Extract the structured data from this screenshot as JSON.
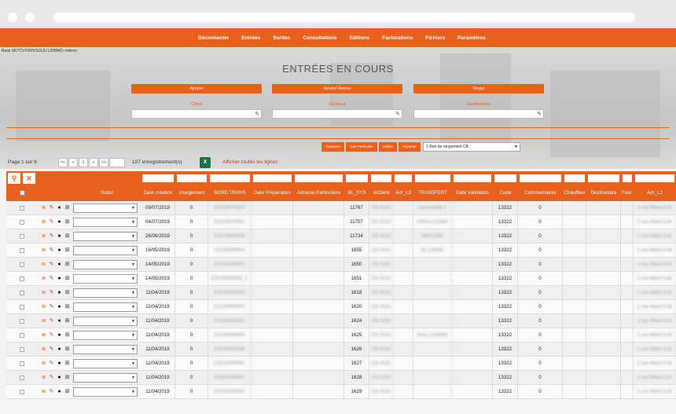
{
  "nav": {
    "items": [
      "Déconnecter",
      "Entrées",
      "Sorties",
      "Consultations",
      "Editions",
      "Facturations",
      "Fichiers",
      "Paramètres"
    ]
  },
  "base_label": "Base SKTCVXXRVSGUIJ UDBMO--ndemo",
  "page_title": "ENTRÉES EN COURS",
  "actions": {
    "add": "Ajouter",
    "add_return": "Ajouter Retour",
    "regul": "Regul"
  },
  "fields": {
    "client": "Client",
    "stockeur": "Stockeur",
    "destinataire": "Destinataire"
  },
  "small_buttons": [
    "Transport",
    "Cas Particulier",
    "Valider",
    "Imprimer"
  ],
  "doc_select": "1-Bon de rangement CB",
  "pagination": {
    "info": "Page 1 sur 6",
    "first": "<<",
    "prev": "<",
    "current": "1",
    "next": ">",
    "last": ">>",
    "records": "107 enregistrement(s)",
    "show_all": "Afficher toutes les lignes",
    "excel_letter": "X"
  },
  "icons": {
    "search": "search-icon",
    "clear": "close-icon"
  },
  "table": {
    "columns": [
      "Statut",
      "Date création",
      "chargement",
      "BORD TRANS",
      "Date Préparation",
      "Adresse Particuliere",
      "BL_SYS",
      "IoClient",
      "Adr_L3",
      "TRANSFERT",
      "Date Validation",
      "Code",
      "Commentaires",
      "Chauffeur",
      "Destinataire",
      "Four.",
      "Adr_L1"
    ],
    "rows": [
      {
        "date": "09/07/2019",
        "charg": "0",
        "bord": "E2019070004",
        "bl": "11767",
        "client": "CD-SUD",
        "transfert": "commande 1",
        "code": "13322",
        "comment": "0",
        "adr": "1 rue Albert Coll"
      },
      {
        "date": "04/07/2019",
        "charg": "0",
        "bord": "E2019070001",
        "bl": "11757",
        "client": "CD-SUD",
        "transfert": "CMAU123456",
        "code": "13322",
        "comment": "0",
        "adr": "1 rue Albert Coll"
      },
      {
        "date": "26/06/2019",
        "charg": "0",
        "bord": "E2019060006",
        "bl": "11734",
        "client": "CD-SUD",
        "transfert": "NM12359",
        "code": "13322",
        "comment": "0",
        "adr": "1 rue Albert Coll"
      },
      {
        "date": "16/05/2019",
        "charg": "0",
        "bord": "E2019050004",
        "bl": "1655",
        "client": "CD-SUD",
        "transfert": "BL123456",
        "code": "13322",
        "comment": "0",
        "adr": "1 rue Albert Coll"
      },
      {
        "date": "14/05/2019",
        "charg": "0",
        "bord": "E2019050003",
        "bl": "1650",
        "client": "CD-SUD",
        "transfert": "",
        "code": "13322",
        "comment": "0",
        "adr": "1 rue Albert Coll"
      },
      {
        "date": "14/05/2019",
        "charg": "0",
        "bord": "E2019050003_T",
        "bl": "1651",
        "client": "CD-SUD",
        "transfert": "",
        "code": "13322",
        "comment": "0",
        "adr": "1 rue Albert Coll"
      },
      {
        "date": "11/04/2019",
        "charg": "0",
        "bord": "E2019040049",
        "bl": "1618",
        "client": "CD-SUD",
        "transfert": "",
        "code": "13322",
        "comment": "0",
        "adr": "1 rue Albert Coll"
      },
      {
        "date": "11/04/2019",
        "charg": "0",
        "bord": "E2019040050",
        "bl": "1620",
        "client": "CD-SUD",
        "transfert": "",
        "code": "13322",
        "comment": "0",
        "adr": "1 rue Albert Coll"
      },
      {
        "date": "11/04/2019",
        "charg": "0",
        "bord": "E2019040055",
        "bl": "1624",
        "client": "CD-SUD",
        "transfert": "",
        "code": "13322",
        "comment": "0",
        "adr": "1 rue Albert Coll"
      },
      {
        "date": "11/04/2019",
        "charg": "0",
        "bord": "E2019040054",
        "bl": "1625",
        "client": "CD-SUD",
        "transfert": "chau 1234456",
        "code": "13322",
        "comment": "0",
        "adr": "1 rue Albert Coll"
      },
      {
        "date": "11/04/2019",
        "charg": "0",
        "bord": "E2019040056",
        "bl": "1626",
        "client": "CD-SUD",
        "transfert": "",
        "code": "13322",
        "comment": "0",
        "adr": "1 rue Albert Coll"
      },
      {
        "date": "11/04/2019",
        "charg": "0",
        "bord": "E2019040060",
        "bl": "1627",
        "client": "CD-SUD",
        "transfert": "",
        "code": "13322",
        "comment": "0",
        "adr": "1 rue Albert Coll"
      },
      {
        "date": "11/04/2019",
        "charg": "0",
        "bord": "E2019040061",
        "bl": "1628",
        "client": "CD-SUD",
        "transfert": "",
        "code": "13322",
        "comment": "0",
        "adr": "1 rue Albert Coll"
      },
      {
        "date": "11/04/2019",
        "charg": "0",
        "bord": "E2019040063",
        "bl": "1629",
        "client": "CD-SUD",
        "transfert": "",
        "code": "13322",
        "comment": "0",
        "adr": "1 rue Albert Coll"
      }
    ]
  },
  "colors": {
    "accent": "#e8601c"
  }
}
